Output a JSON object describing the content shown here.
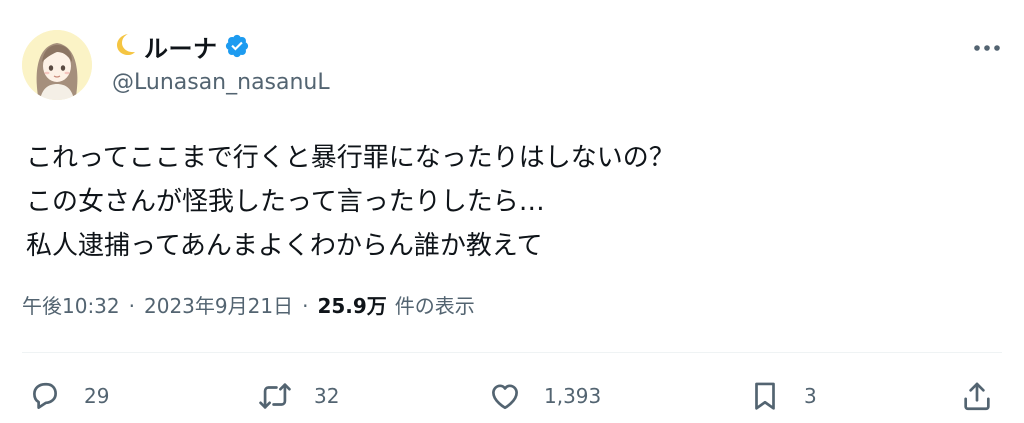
{
  "author": {
    "display_name": "ルーナ",
    "name_prefix_icon": "crescent-moon-emoji",
    "verified_icon": "verified-badge-icon",
    "handle": "@Lunasan_nasanuL"
  },
  "tweet": {
    "lines": [
      "これってここまで行くと暴行罪になったりはしないの？",
      "この女さんが怪我したって言ったりしたら…",
      "私人逮捕ってあんまよくわからん誰か教えて"
    ]
  },
  "meta": {
    "time": "午後10:32",
    "separator": "·",
    "date": "2023年9月21日",
    "views_count": "25.9万",
    "views_label": "件の表示"
  },
  "actions": {
    "reply_count": "29",
    "retweet_count": "32",
    "like_count": "1,393",
    "bookmark_count": "3"
  },
  "colors": {
    "text_primary": "#0f1419",
    "text_secondary": "#536471",
    "verified_blue": "#1d9bf0",
    "divider": "#eff3f4"
  }
}
